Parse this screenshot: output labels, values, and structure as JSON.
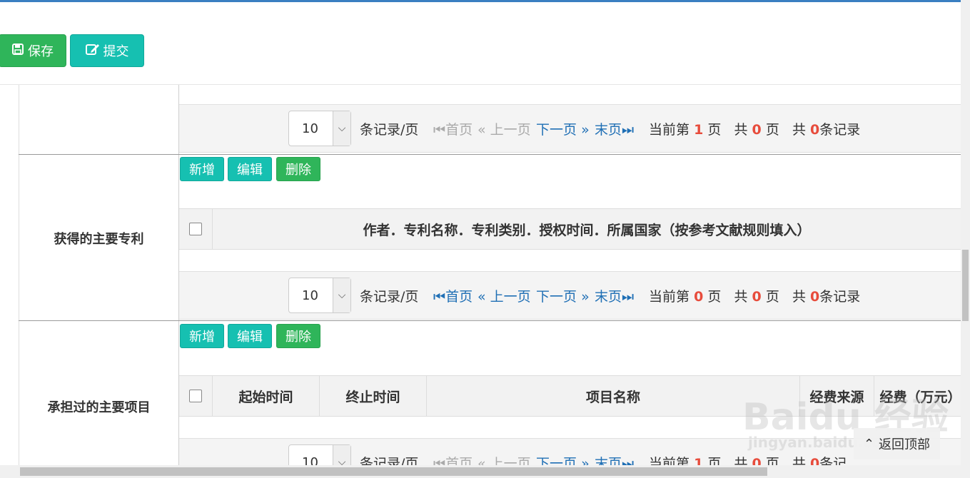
{
  "toolbar": {
    "save_label": "保存",
    "submit_label": "提交"
  },
  "pager": {
    "page_size": "10",
    "records_per_page": "条记录/页",
    "first": "首页",
    "prev": "上一页",
    "next": "下一页",
    "last": "末页",
    "current_prefix": "当前第",
    "page_unit": "页",
    "total_prefix": "共",
    "records_unit": "条记录"
  },
  "actions": {
    "add": "新增",
    "edit": "编辑",
    "delete": "删除"
  },
  "sections": [
    {
      "pager": {
        "current": "1",
        "total_pages": "0",
        "total_records": "0"
      }
    },
    {
      "label": "获得的主要专利",
      "header": "作者．专利名称．专利类别．授权时间．所属国家（按参考文献规则填入）",
      "pager": {
        "current": "0",
        "total_pages": "0",
        "total_records": "0"
      }
    },
    {
      "label": "承担过的主要项目",
      "columns": [
        "起始时间",
        "终止时间",
        "项目名称",
        "经费来源",
        "经费（万元）"
      ],
      "pager": {
        "current": "1",
        "total_pages": "0",
        "total_records": "0",
        "records_unit_cut": "条记"
      }
    }
  ],
  "watermark": {
    "logo": "Baidu 经验",
    "url": "jingyan.baidu.com"
  },
  "back_to_top": "返回顶部",
  "colors": {
    "green": "#2fb55a",
    "teal": "#16c0b1",
    "link_blue": "#1f6fb5",
    "count_red": "#e74c3c"
  }
}
